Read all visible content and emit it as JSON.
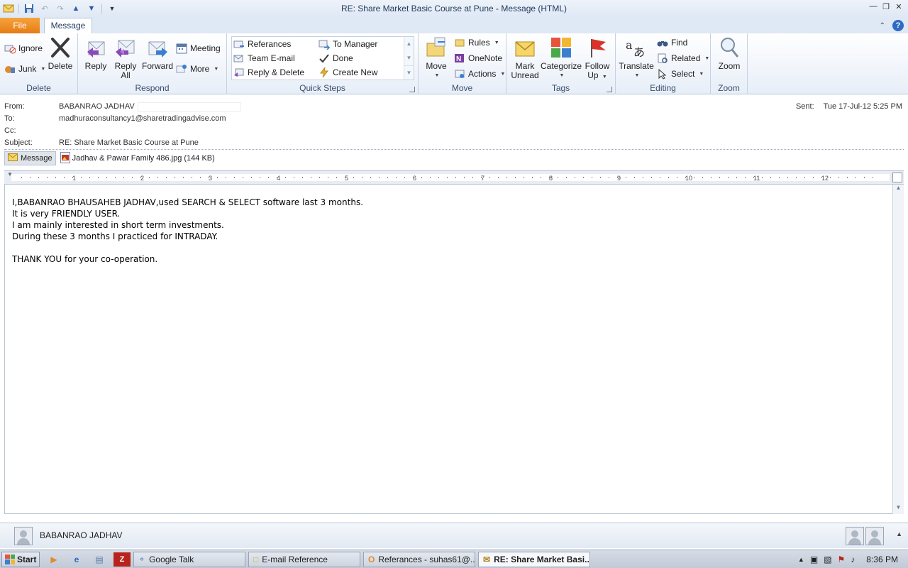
{
  "window": {
    "title": "RE: Share Market Basic Course at Pune - Message (HTML)"
  },
  "tabs": {
    "file": "File",
    "message": "Message"
  },
  "ribbon": {
    "delete_group": {
      "label": "Delete",
      "ignore": "Ignore",
      "junk": "Junk",
      "delete": "Delete"
    },
    "respond_group": {
      "label": "Respond",
      "reply": "Reply",
      "reply_all_1": "Reply",
      "reply_all_2": "All",
      "forward": "Forward",
      "meeting": "Meeting",
      "more": "More"
    },
    "quicksteps_group": {
      "label": "Quick Steps",
      "items": [
        "Referances",
        "To Manager",
        "Team E-mail",
        "Done",
        "Reply & Delete",
        "Create New"
      ]
    },
    "move_group": {
      "label": "Move",
      "move": "Move",
      "rules": "Rules",
      "onenote": "OneNote",
      "actions": "Actions"
    },
    "tags_group": {
      "label": "Tags",
      "mark_unread_1": "Mark",
      "mark_unread_2": "Unread",
      "categorize": "Categorize",
      "follow_up_1": "Follow",
      "follow_up_2": "Up"
    },
    "editing_group": {
      "label": "Editing",
      "translate": "Translate",
      "find": "Find",
      "related": "Related",
      "select": "Select"
    },
    "zoom_group": {
      "label": "Zoom",
      "zoom": "Zoom"
    }
  },
  "header": {
    "from_label": "From:",
    "from_value": "BABANRAO JADHAV",
    "to_label": "To:",
    "to_value": "madhuraconsultancy1@sharetradingadvise.com",
    "cc_label": "Cc:",
    "subject_label": "Subject:",
    "subject_value": "RE: Share Market Basic Course at Pune",
    "sent_label": "Sent:",
    "sent_value": "Tue 17-Jul-12 5:25 PM"
  },
  "attachments": {
    "message_tab": "Message",
    "file": "Jadhav & Pawar Family 486.jpg (144 KB)"
  },
  "ruler": {
    "numbers": [
      "1",
      "2",
      "3",
      "4",
      "5",
      "6",
      "7",
      "8",
      "9",
      "10",
      "11",
      "12"
    ]
  },
  "body": {
    "lines": [
      "I,BABANRAO BHAUSAHEB JADHAV,used SEARCH & SELECT software last 3 months.",
      "It is very FRIENDLY USER.",
      "I am mainly interested in short term investments.",
      "During these 3 months I practiced for INTRADAY.",
      "",
      "THANK YOU for your co-operation."
    ]
  },
  "people_pane": {
    "name": "BABANRAO JADHAV"
  },
  "taskbar": {
    "start": "Start",
    "tasks": [
      "Google Talk",
      "E-mail Reference",
      "Referances - suhas61@...",
      "RE: Share Market Basi..."
    ],
    "clock": "8:36 PM"
  },
  "colors": {
    "file_tab": "#e57c14",
    "ribbon_bg": "#e7eef8",
    "accent": "#2e6bc4"
  }
}
